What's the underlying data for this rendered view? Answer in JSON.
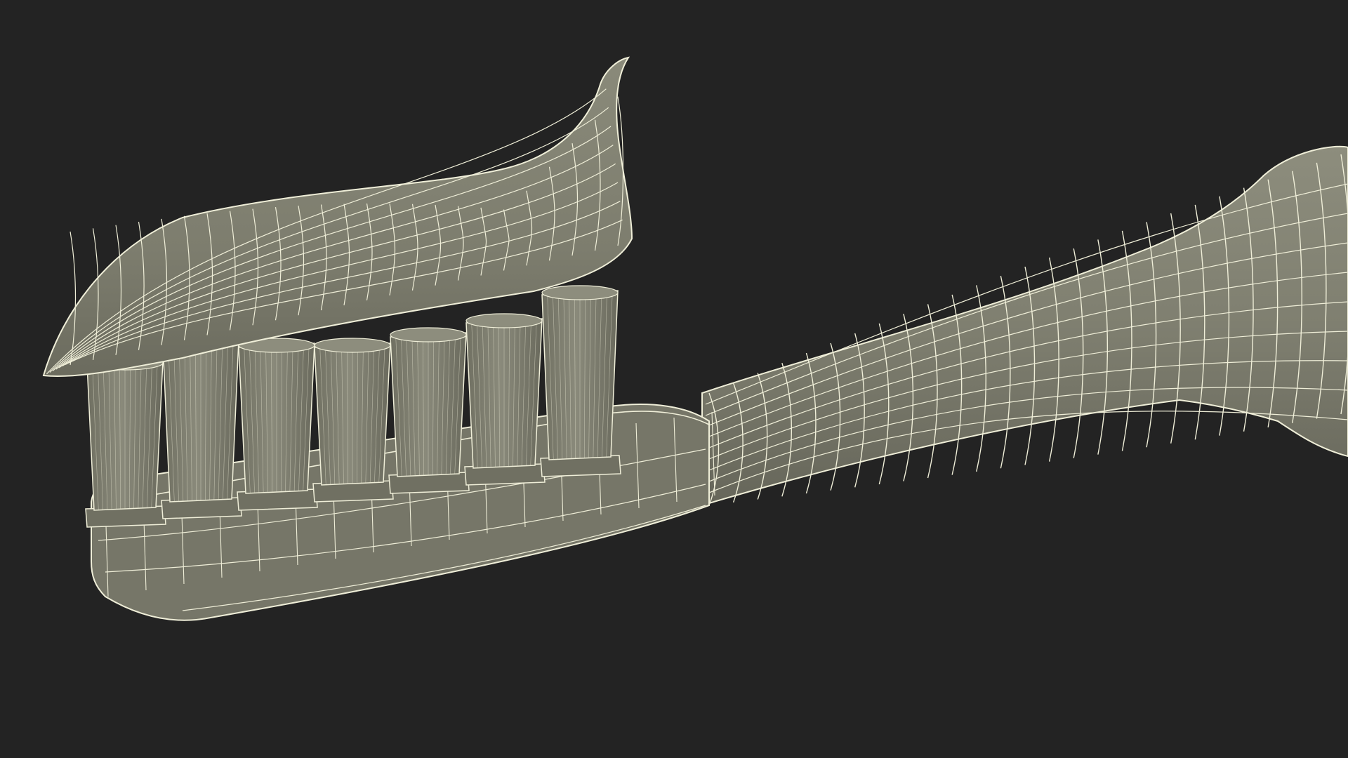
{
  "viewport": {
    "background_color": "#232323"
  },
  "model": {
    "subject": "toothbrush-with-toothpaste",
    "render_style": "wireframe-over-shaded",
    "surface_color": "#7f7f70",
    "surface_shade_color": "#6f6f61",
    "surface_light_color": "#8d8d7d",
    "wire_color": "#efeed8",
    "bristle_tuft_count": 7
  }
}
